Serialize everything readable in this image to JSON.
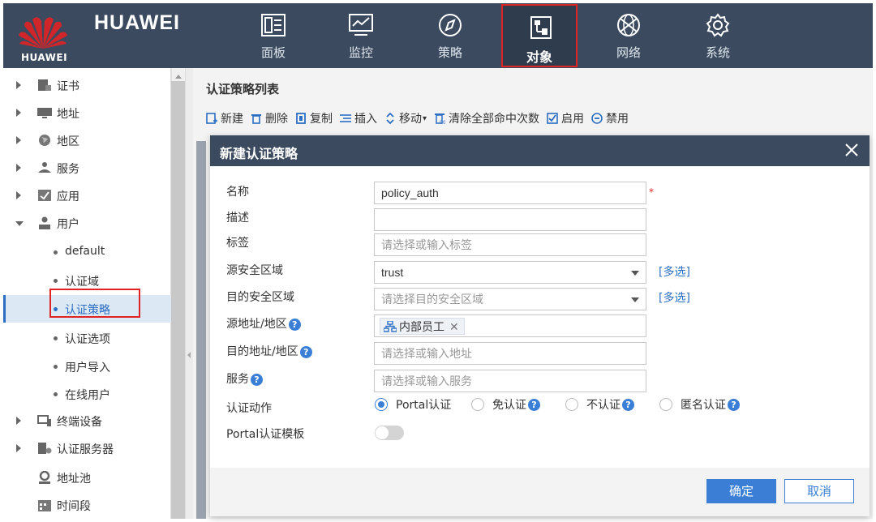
{
  "header": {
    "brand": "HUAWEI",
    "logo_text": "HUAWEI",
    "nav": [
      {
        "label": "面板",
        "icon": "dashboard-icon"
      },
      {
        "label": "监控",
        "icon": "monitor-icon"
      },
      {
        "label": "策略",
        "icon": "compass-icon"
      },
      {
        "label": "对象",
        "icon": "object-icon",
        "active": true
      },
      {
        "label": "网络",
        "icon": "network-icon"
      },
      {
        "label": "系统",
        "icon": "gear-icon"
      }
    ]
  },
  "sidebar": {
    "items": [
      {
        "label": "证书",
        "icon": "certificate-icon"
      },
      {
        "label": "地址",
        "icon": "address-icon"
      },
      {
        "label": "地区",
        "icon": "globe-icon"
      },
      {
        "label": "服务",
        "icon": "service-icon"
      },
      {
        "label": "应用",
        "icon": "application-icon"
      },
      {
        "label": "用户",
        "icon": "user-icon",
        "expanded": true
      }
    ],
    "user_children": [
      {
        "label": "default"
      },
      {
        "label": "认证域"
      },
      {
        "label": "认证策略",
        "selected": true
      },
      {
        "label": "认证选项"
      },
      {
        "label": "用户导入"
      },
      {
        "label": "在线用户"
      }
    ],
    "items_after": [
      {
        "label": "终端设备",
        "icon": "terminal-icon"
      },
      {
        "label": "认证服务器",
        "icon": "server-icon"
      },
      {
        "label": "地址池",
        "icon": "location-pin-icon"
      },
      {
        "label": "时间段",
        "icon": "calendar-icon"
      }
    ]
  },
  "main": {
    "title": "认证策略列表",
    "toolbar": {
      "new": "新建",
      "delete": "删除",
      "copy": "复制",
      "insert": "插入",
      "move": "移动",
      "clear": "清除全部命中次数",
      "enable": "启用",
      "disable": "禁用"
    }
  },
  "dialog": {
    "title": "新建认证策略",
    "fields": {
      "name_label": "名称",
      "name_value": "policy_auth",
      "desc_label": "描述",
      "desc_value": "",
      "tag_label": "标签",
      "tag_placeholder": "请选择或输入标签",
      "src_zone_label": "源安全区域",
      "src_zone_value": "trust",
      "dst_zone_label": "目的安全区域",
      "dst_zone_placeholder": "请选择目的安全区域",
      "multi_select": "[多选]",
      "src_addr_label": "源地址/地区",
      "src_addr_tag": "内部员工",
      "dst_addr_label": "目的地址/地区",
      "dst_addr_placeholder": "请选择或输入地址",
      "service_label": "服务",
      "service_placeholder": "请选择或输入服务",
      "auth_action_label": "认证动作",
      "auth_options": [
        {
          "label": "Portal认证",
          "checked": true,
          "help": false
        },
        {
          "label": "免认证",
          "checked": false,
          "help": true
        },
        {
          "label": "不认证",
          "checked": false,
          "help": true
        },
        {
          "label": "匿名认证",
          "checked": false,
          "help": true
        }
      ],
      "portal_template_label": "Portal认证模板",
      "portal_template_enabled": false,
      "required_mark": "*",
      "help_glyph": "?"
    },
    "ok": "确定",
    "cancel": "取消"
  }
}
